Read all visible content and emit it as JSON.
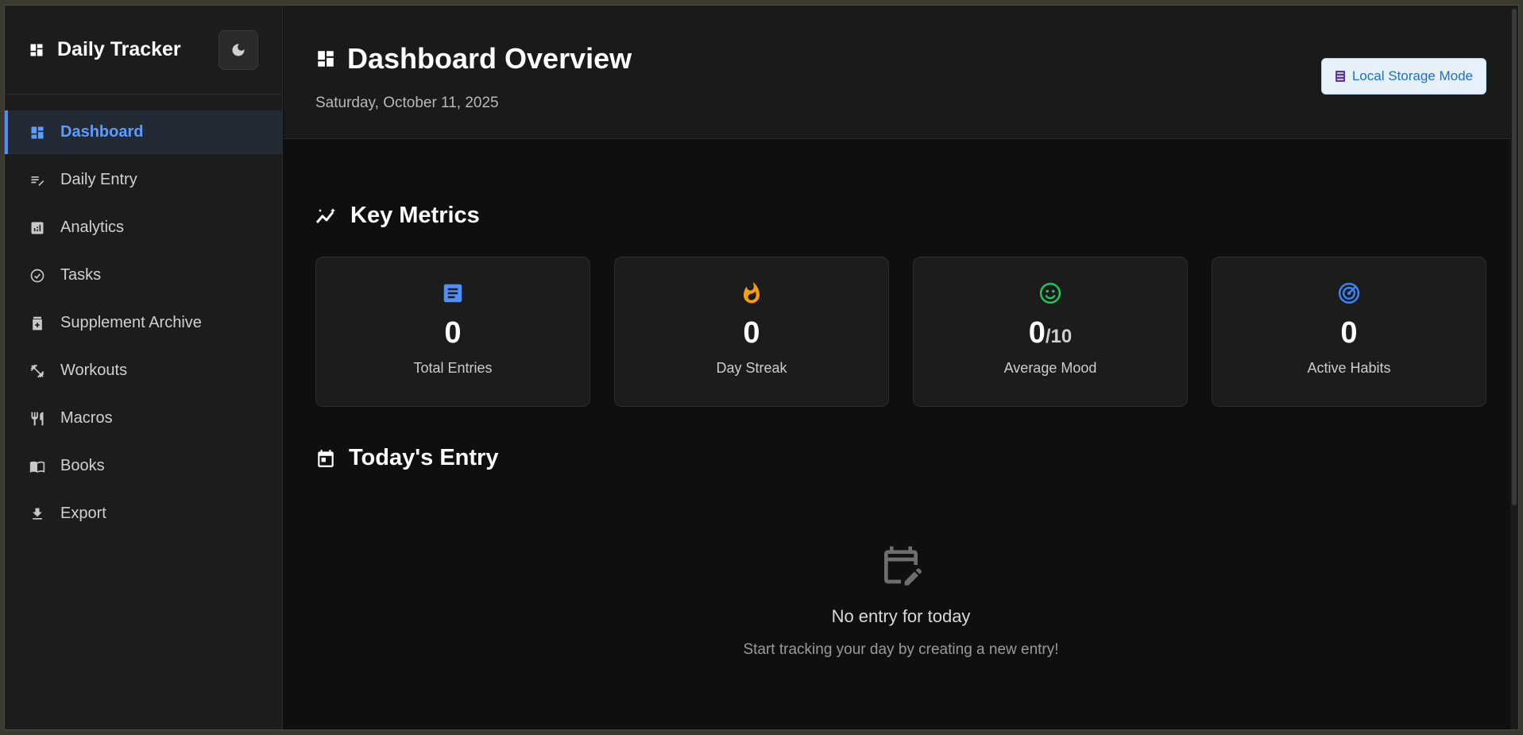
{
  "app": {
    "title": "Daily Tracker"
  },
  "sidebar": {
    "items": [
      {
        "label": "Dashboard",
        "icon": "dashboard-icon",
        "active": true
      },
      {
        "label": "Daily Entry",
        "icon": "edit-notes-icon"
      },
      {
        "label": "Analytics",
        "icon": "analytics-icon"
      },
      {
        "label": "Tasks",
        "icon": "check-circle-icon"
      },
      {
        "label": "Supplement Archive",
        "icon": "medication-icon"
      },
      {
        "label": "Workouts",
        "icon": "fitness-icon"
      },
      {
        "label": "Macros",
        "icon": "restaurant-icon"
      },
      {
        "label": "Books",
        "icon": "book-icon"
      },
      {
        "label": "Export",
        "icon": "download-icon"
      }
    ]
  },
  "header": {
    "title": "Dashboard Overview",
    "date": "Saturday, October 11, 2025",
    "storage_label": "Local Storage Mode"
  },
  "metrics": {
    "title": "Key Metrics",
    "cards": [
      {
        "value": "0",
        "suffix": "",
        "label": "Total Entries",
        "icon": "article-icon",
        "color": "#4f8ff7"
      },
      {
        "value": "0",
        "suffix": "",
        "label": "Day Streak",
        "icon": "fire-icon",
        "color": "#f59e0b"
      },
      {
        "value": "0",
        "suffix": "/10",
        "label": "Average Mood",
        "icon": "smile-icon",
        "color": "#22c55e"
      },
      {
        "value": "0",
        "suffix": "",
        "label": "Active Habits",
        "icon": "target-icon",
        "color": "#3b82f6"
      }
    ]
  },
  "today": {
    "title": "Today's Entry",
    "empty_title": "No entry for today",
    "empty_subtitle": "Start tracking your day by creating a new entry!"
  },
  "colors": {
    "accent": "#4f8ff7",
    "background": "#0f0f0f",
    "sidebar": "#1c1c1c"
  }
}
